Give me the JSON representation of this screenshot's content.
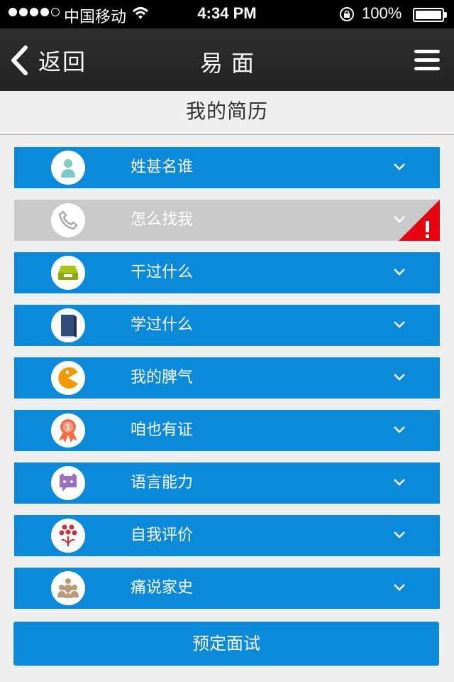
{
  "status_bar": {
    "carrier": "中国移动",
    "time": "4:34 PM",
    "battery": "100%"
  },
  "nav": {
    "back_label": "返回",
    "title": "易面"
  },
  "page": {
    "heading": "我的简历"
  },
  "sections": [
    {
      "label": "姓甚名谁",
      "icon": "person-icon",
      "state": "active"
    },
    {
      "label": "怎么找我",
      "icon": "phone-icon",
      "state": "disabled-warning"
    },
    {
      "label": "干过什么",
      "icon": "inbox-tray-icon",
      "state": "active"
    },
    {
      "label": "学过什么",
      "icon": "book-icon",
      "state": "active"
    },
    {
      "label": "我的脾气",
      "icon": "pacman-icon",
      "state": "active"
    },
    {
      "label": "咱也有证",
      "icon": "award-ribbon-icon",
      "state": "active"
    },
    {
      "label": "语言能力",
      "icon": "chat-bubble-icon",
      "state": "active"
    },
    {
      "label": "自我评价",
      "icon": "flower-icon",
      "state": "active"
    },
    {
      "label": "痛说家史",
      "icon": "family-icon",
      "state": "active"
    }
  ],
  "footer": {
    "button_label": "预定面试"
  },
  "colors": {
    "primary": "#0b8ad9",
    "disabled": "#c9c9c9",
    "warning": "#e60012",
    "navbar": "#2a2a2a"
  }
}
